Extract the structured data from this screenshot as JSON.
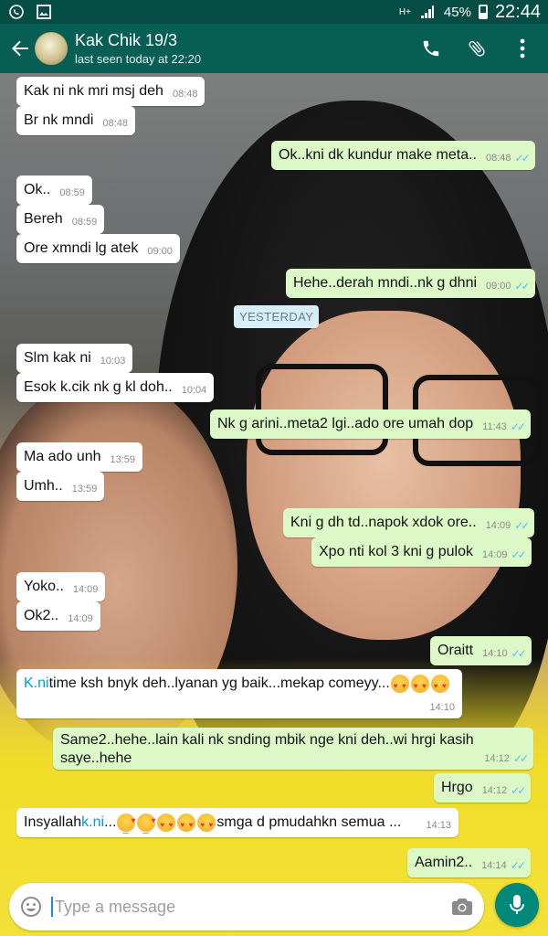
{
  "status_bar": {
    "battery_percent": "45%",
    "time": "22:44",
    "network": "H+"
  },
  "header": {
    "title": "Kak Chik 19/3",
    "subtitle": "last seen today at 22:20"
  },
  "date_separator": "YESTERDAY",
  "messages": [
    {
      "dir": "in",
      "text": "Kak ni nk mri msj deh",
      "time": "08:48"
    },
    {
      "dir": "in",
      "text": "Br nk mndi",
      "time": "08:48"
    },
    {
      "dir": "out",
      "text": "Ok..kni dk kundur make meta..",
      "time": "08:48"
    },
    {
      "dir": "in",
      "text": "Ok..",
      "time": "08:59"
    },
    {
      "dir": "in",
      "text": "Bereh",
      "time": "08:59"
    },
    {
      "dir": "in",
      "text": "Ore xmndi lg atek",
      "time": "09:00"
    },
    {
      "dir": "out",
      "text": "Hehe..derah mndi..nk g dhni",
      "time": "09:00"
    },
    {
      "dir": "in",
      "text": "Slm kak ni",
      "time": "10:03"
    },
    {
      "dir": "in",
      "text": "Esok k.cik nk g kl doh..",
      "time": "10:04"
    },
    {
      "dir": "out",
      "text": "Nk g arini..meta2 lgi..ado ore umah dop",
      "time": "11:43"
    },
    {
      "dir": "in",
      "text": "Ma ado unh",
      "time": "13:59"
    },
    {
      "dir": "in",
      "text": "Umh..",
      "time": "13:59"
    },
    {
      "dir": "out",
      "text": "Kni g dh td..napok xdok ore..",
      "time": "14:09"
    },
    {
      "dir": "out",
      "text": "Xpo nti kol 3 kni g pulok",
      "time": "14:09"
    },
    {
      "dir": "in",
      "text": "Yoko..",
      "time": "14:09"
    },
    {
      "dir": "in",
      "text": "Ok2..",
      "time": "14:09"
    },
    {
      "dir": "out",
      "text": "Oraitt",
      "time": "14:10"
    },
    {
      "dir": "in",
      "link": "K.ni",
      "text": " time ksh bnyk deh..lyanan yg baik...mekap comeyy...",
      "time": "14:10"
    },
    {
      "dir": "out",
      "line1": "Same2..hehe..lain kali nk snding mbik nge kni deh..wi hrgi kasih",
      "line2": "saye..hehe",
      "time": "14:12"
    },
    {
      "dir": "out",
      "text": "Hrgo",
      "time": "14:12"
    },
    {
      "dir": "in",
      "text_before": "Insyallah ",
      "link": "k.ni",
      "text_mid": "...",
      "text_after": "smga d pmudahkn semua ...",
      "time": "14:13"
    },
    {
      "dir": "out",
      "text": "Aamin2..",
      "time": "14:14"
    }
  ],
  "input": {
    "placeholder": "Type a message"
  },
  "icons": {
    "back": "arrow-left-icon",
    "call": "phone-icon",
    "attach": "paperclip-icon",
    "menu": "more-vert-icon",
    "emoji": "smiley-icon",
    "camera": "camera-icon",
    "mic": "mic-icon"
  },
  "colors": {
    "app_bar": "#075e54",
    "status_bar": "#054d44",
    "outgoing_bubble": "#dcf8c6",
    "incoming_bubble": "#ffffff",
    "read_ticks": "#4fc3f7",
    "mic_button": "#00897b"
  }
}
